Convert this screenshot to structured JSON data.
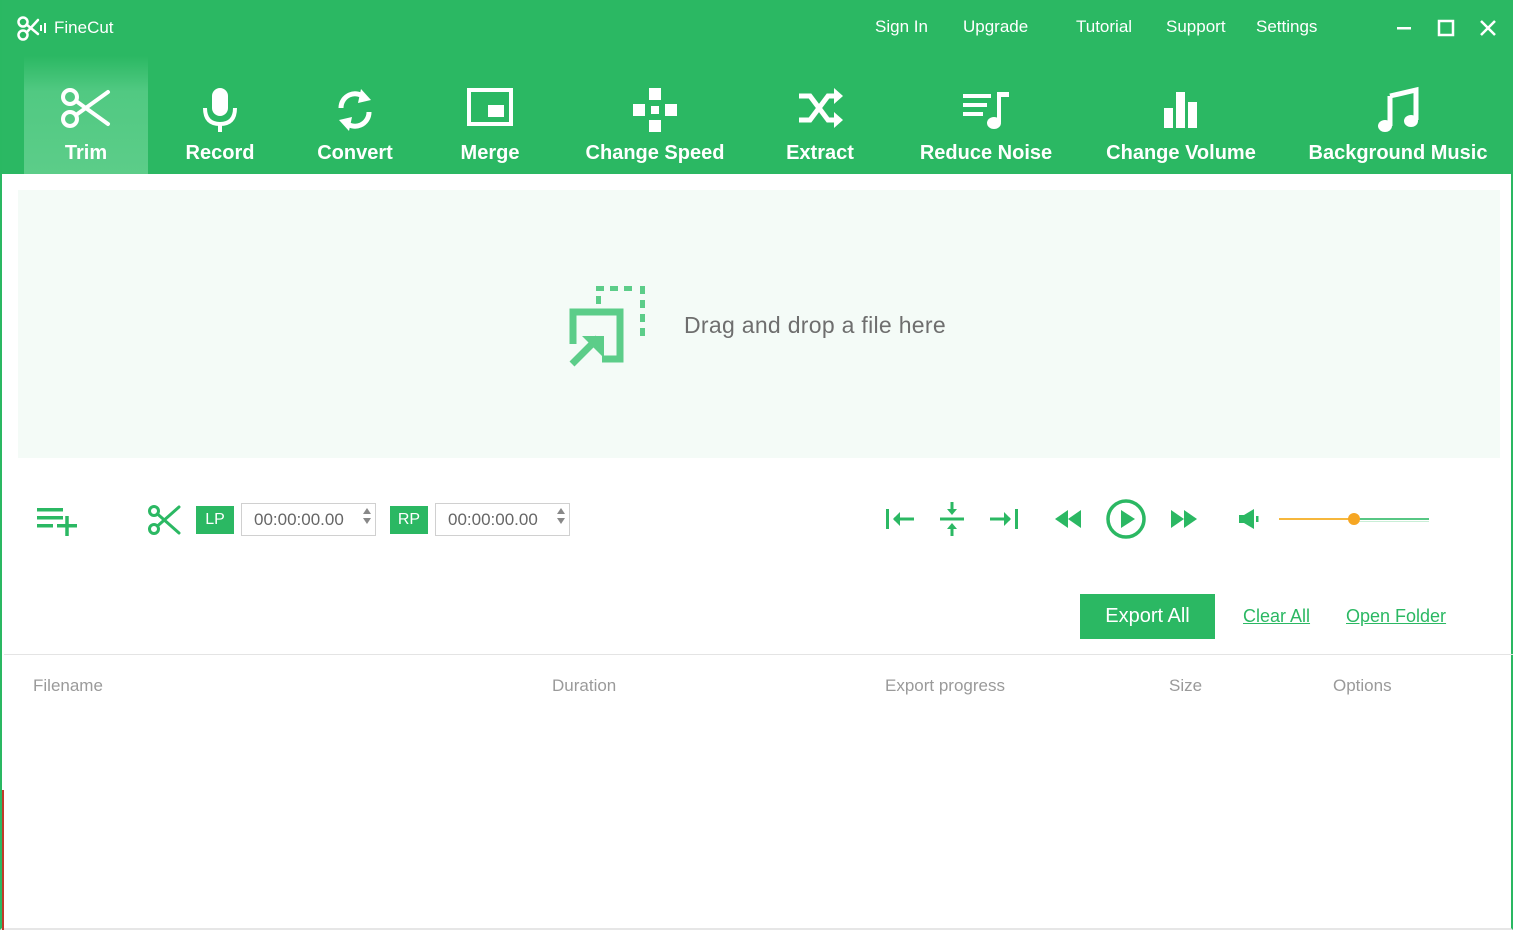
{
  "app": {
    "name": "FineCut"
  },
  "topnav": {
    "sign_in": "Sign In",
    "upgrade": "Upgrade",
    "tutorial": "Tutorial",
    "support": "Support",
    "settings": "Settings"
  },
  "tabs": [
    {
      "label": "Trim",
      "icon": "scissors-icon",
      "active": true
    },
    {
      "label": "Record",
      "icon": "microphone-icon"
    },
    {
      "label": "Convert",
      "icon": "refresh-icon"
    },
    {
      "label": "Merge",
      "icon": "merge-icon"
    },
    {
      "label": "Change Speed",
      "icon": "speed-icon"
    },
    {
      "label": "Extract",
      "icon": "shuffle-icon"
    },
    {
      "label": "Reduce Noise",
      "icon": "noise-icon"
    },
    {
      "label": "Change Volume",
      "icon": "volume-bars-icon"
    },
    {
      "label": "Background Music",
      "icon": "music-note-icon"
    }
  ],
  "dropzone": {
    "text": "Drag and drop a file here"
  },
  "trim": {
    "lp_label": "LP",
    "lp_value": "00:00:00.00",
    "rp_label": "RP",
    "rp_value": "00:00:00.00"
  },
  "volume": {
    "level": 0.5
  },
  "actions": {
    "export_all": "Export All",
    "clear_all": "Clear All",
    "open_folder": "Open Folder"
  },
  "table": {
    "columns": [
      "Filename",
      "Duration",
      "Export progress",
      "Size",
      "Options"
    ]
  },
  "colors": {
    "brand": "#2bb863",
    "drop_bg": "#f4fbf7",
    "slider_accent": "#f6a623"
  }
}
